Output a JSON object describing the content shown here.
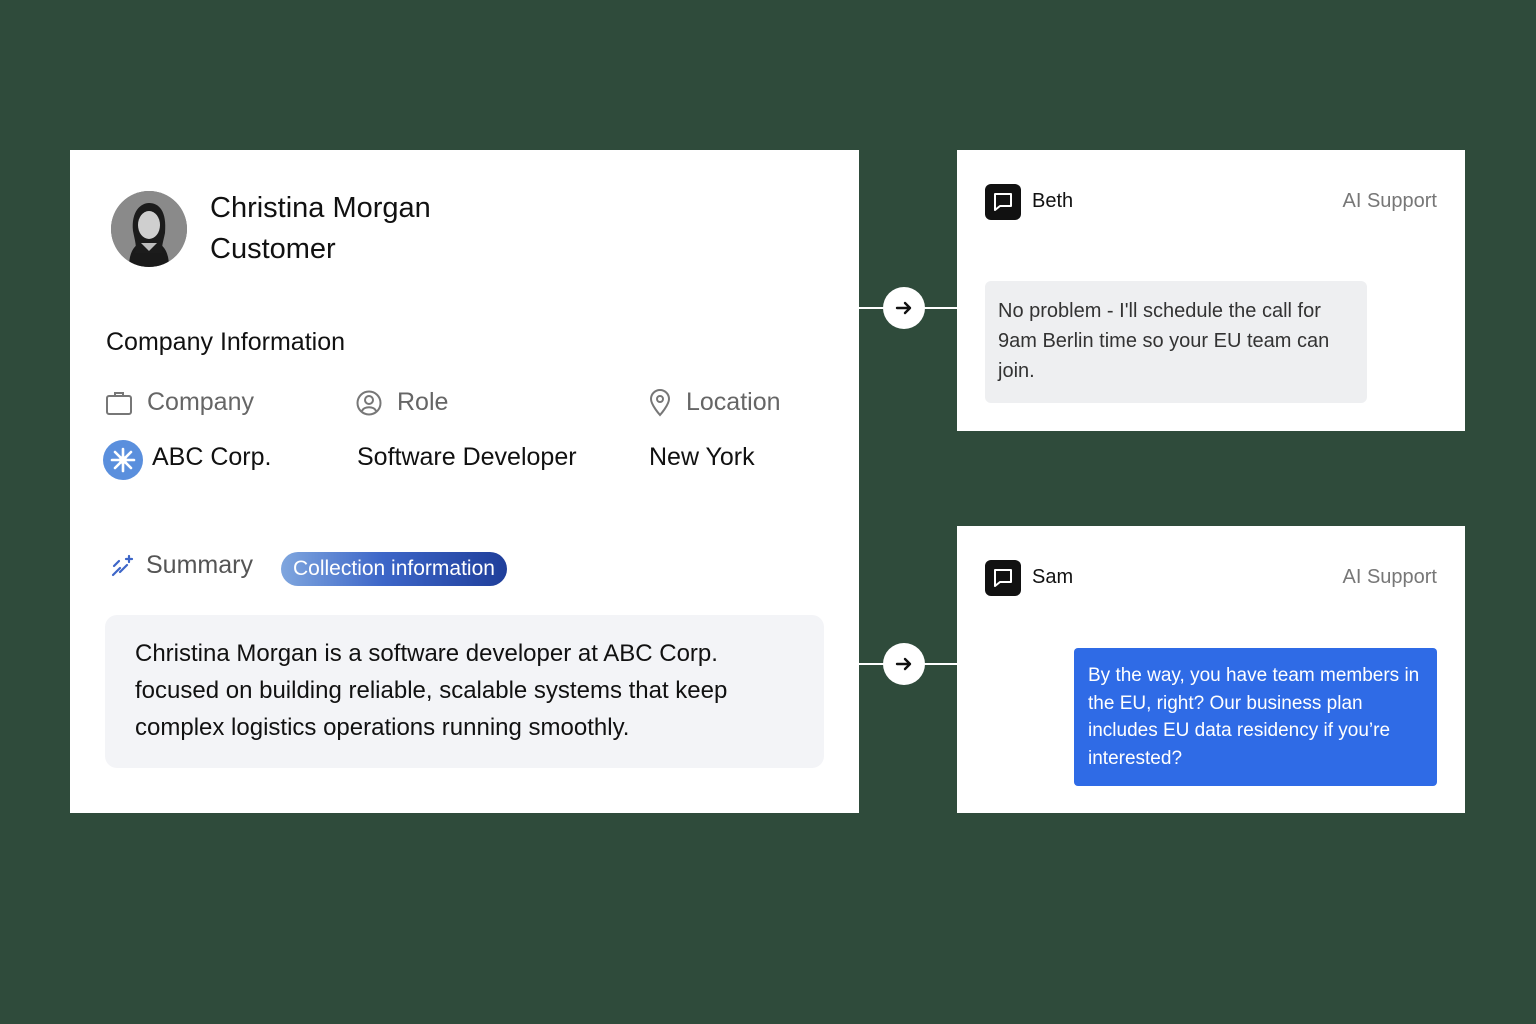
{
  "profile": {
    "name": "Christina Morgan",
    "role": "Customer",
    "section_title": "Company Information",
    "fields": {
      "company_label": "Company",
      "role_label": "Role",
      "location_label": "Location",
      "company_value": "ABC Corp.",
      "role_value": "Software Developer",
      "location_value": "New York"
    },
    "summary_label": "Summary",
    "summary_pill": "Collection information",
    "summary_text": "Christina Morgan is a software developer at ABC Corp. focused on building reliable, scalable systems that keep complex logistics operations running smoothly."
  },
  "chats": [
    {
      "agent": "Beth",
      "tag": "AI Support",
      "message": "No problem - I'll schedule the call for 9am Berlin time so your EU team can join."
    },
    {
      "agent": "Sam",
      "tag": "AI Support",
      "message": "By the way, you have team members in the EU, right? Our business plan includes EU data residency if you’re interested?"
    }
  ],
  "colors": {
    "background": "#2f4b3b",
    "accent_blue": "#2f6be6",
    "company_logo": "#5a8fdd"
  }
}
